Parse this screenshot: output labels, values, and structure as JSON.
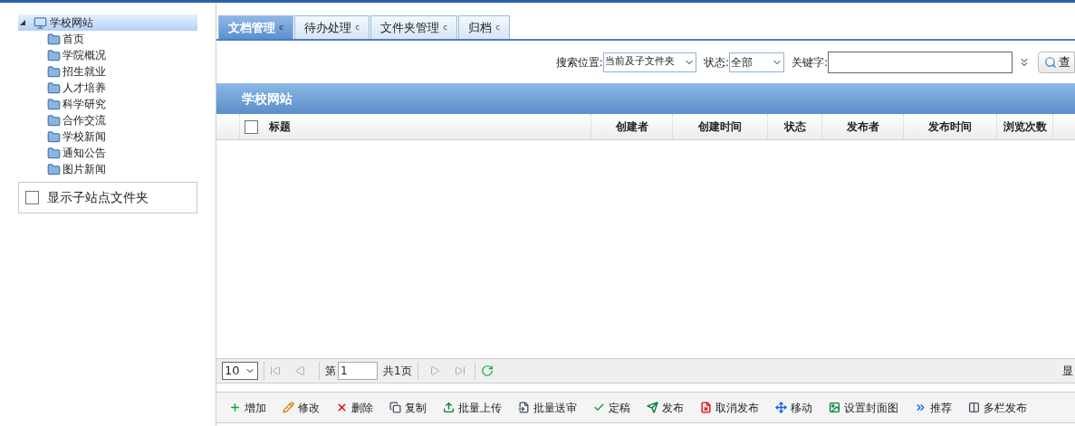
{
  "tree": {
    "label": "学校网站",
    "expanded": true,
    "selected": true,
    "children": [
      {
        "label": "首页",
        "selected": false
      },
      {
        "label": "学院概况",
        "selected": false
      },
      {
        "label": "招生就业",
        "selected": false
      },
      {
        "label": "人才培养",
        "selected": false
      },
      {
        "label": "科学研究",
        "selected": false
      },
      {
        "label": "合作交流",
        "selected": false
      },
      {
        "label": "学校新闻",
        "selected": false
      },
      {
        "label": "通知公告",
        "selected": false
      },
      {
        "label": "图片新闻",
        "selected": false
      }
    ]
  },
  "show_subsite_folders": {
    "label": "显示子站点文件夹",
    "checked": false
  },
  "tabs": [
    {
      "label": "文档管理",
      "icon": "c",
      "selected": true
    },
    {
      "label": "待办处理",
      "icon": "c",
      "selected": false
    },
    {
      "label": "文件夹管理",
      "icon": "c",
      "selected": false
    },
    {
      "label": "归档",
      "icon": "c",
      "selected": false
    }
  ],
  "search": {
    "location_label": "搜索位置:",
    "location_value": "当前及子文件夹",
    "status_label": "状态:",
    "status_value": "全部",
    "keyword_label": "关键字:",
    "search_button": "查"
  },
  "grid": {
    "title": "学校网站",
    "header_checked": false,
    "columns": [
      "标题",
      "创建者",
      "创建时间",
      "状态",
      "发布者",
      "发布时间",
      "浏览次数"
    ]
  },
  "pager": {
    "page_size": "10",
    "page_label": "第",
    "page_value": "1",
    "total": "共1页",
    "right_text": "显"
  },
  "toolbar": [
    "增加",
    "修改",
    "删除",
    "复制",
    "批量上传",
    "批量送审",
    "定稿",
    "发布",
    "取消发布",
    "移动",
    "设置封面图",
    "推荐",
    "多栏发布"
  ]
}
